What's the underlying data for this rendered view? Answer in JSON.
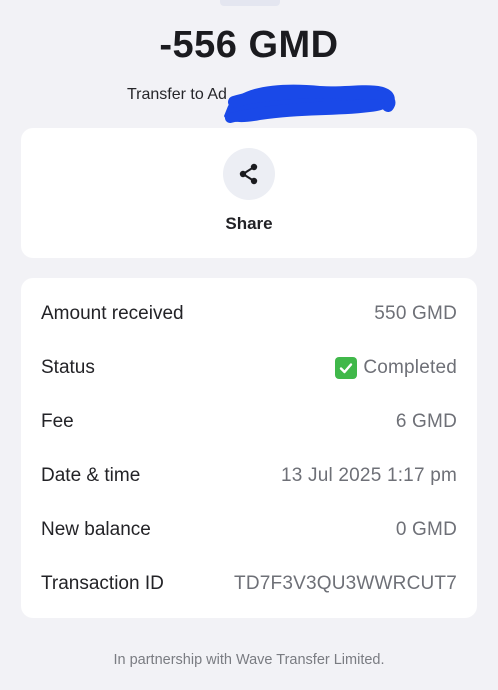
{
  "header": {
    "amount": "-556 GMD",
    "subtitle": "Transfer to Ad"
  },
  "actions": {
    "share_label": "Share",
    "share_icon": "share-icon"
  },
  "details": [
    {
      "label": "Amount received",
      "value": "550 GMD"
    },
    {
      "label": "Status",
      "value": "Completed",
      "icon": "check-mark-icon"
    },
    {
      "label": "Fee",
      "value": "6 GMD"
    },
    {
      "label": "Date & time",
      "value": "13 Jul 2025 1:17 pm"
    },
    {
      "label": "New balance",
      "value": "0 GMD"
    },
    {
      "label": "Transaction ID",
      "value": "TD7F3V3QU3WWRCUT7"
    }
  ],
  "footer": {
    "text": "In partnership with Wave Transfer Limited."
  },
  "colors": {
    "background": "#f2f2f6",
    "card": "#ffffff",
    "status_check": "#40b84a",
    "redaction": "#1a49e8"
  }
}
